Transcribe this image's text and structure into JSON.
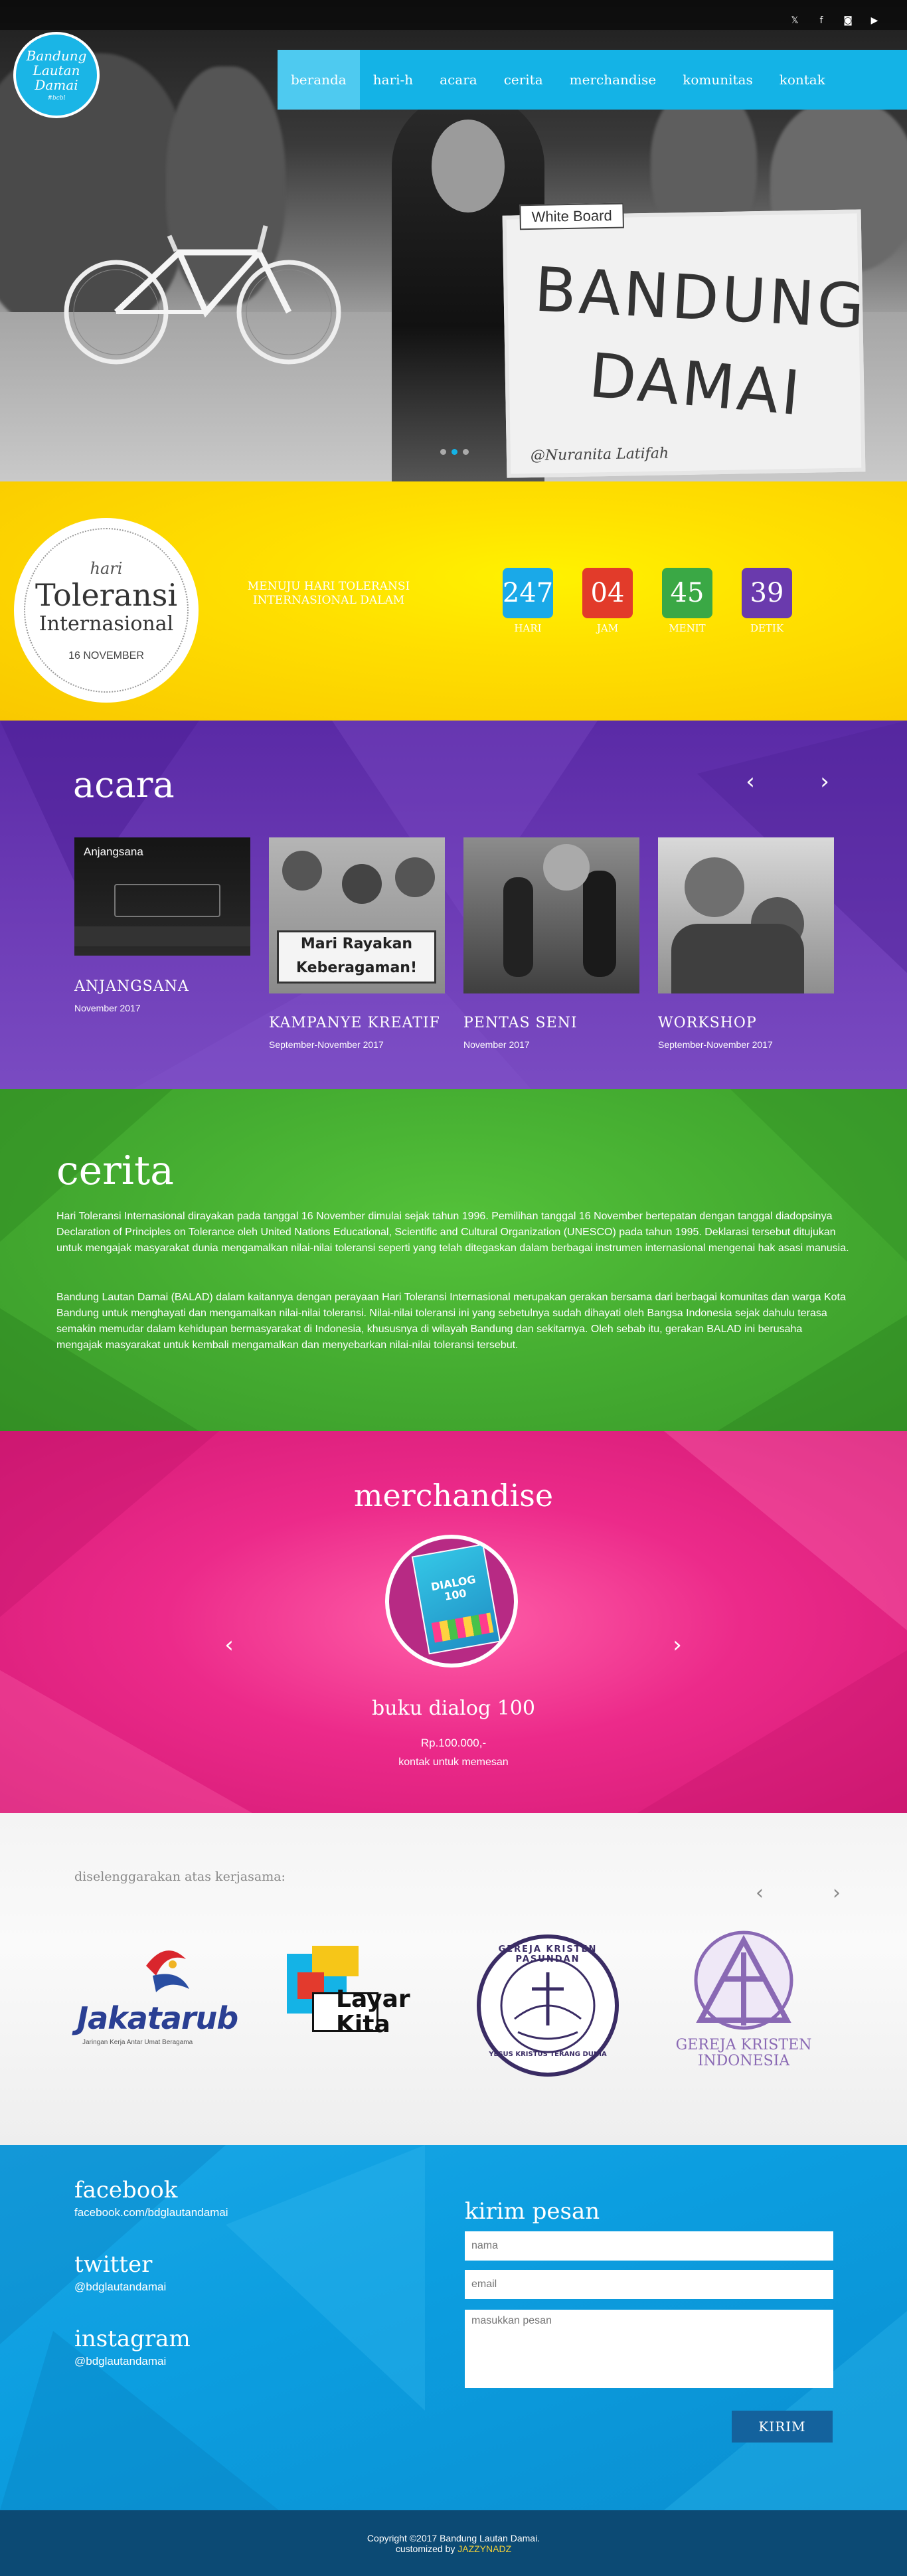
{
  "hero": {
    "social": [
      {
        "icon": "twitter-icon",
        "glyph": "𝕏"
      },
      {
        "icon": "facebook-icon",
        "glyph": "f"
      },
      {
        "icon": "instagram-icon",
        "glyph": "◙"
      },
      {
        "icon": "youtube-icon",
        "glyph": "▶"
      }
    ],
    "logo": {
      "line1": "Bandung",
      "line2": "Lautan",
      "line3": "Damai",
      "tagline": "#bcbl"
    },
    "nav": [
      {
        "label": "beranda",
        "active": true
      },
      {
        "label": "hari-h"
      },
      {
        "label": "acara"
      },
      {
        "label": "cerita"
      },
      {
        "label": "merchandise"
      },
      {
        "label": "komunitas"
      },
      {
        "label": "kontak"
      }
    ],
    "whiteboard": {
      "tag": "White Board",
      "line1": "BANDUNG",
      "line2": "DAMAI",
      "sign": "@Nuranita Latifah"
    }
  },
  "countdown": {
    "badge": {
      "hari": "hari",
      "toleransi": "Toleransi",
      "internasional": "Internasional",
      "date": "16 NOVEMBER"
    },
    "menuju": "MENUJU HARI TOLERANSI INTERNASIONAL DALAM",
    "items": [
      {
        "value": "247",
        "label": "HARI",
        "color": "#1aa9e8"
      },
      {
        "value": "04",
        "label": "JAM",
        "color": "#e23b2a"
      },
      {
        "value": "45",
        "label": "MENIT",
        "color": "#3aa845"
      },
      {
        "value": "39",
        "label": "DETIK",
        "color": "#6a3aad"
      }
    ]
  },
  "acara": {
    "title": "acara",
    "prev": "‹",
    "next": "›",
    "events": [
      {
        "title": "ANJANGSANA",
        "date": "November 2017",
        "img_caption": "Anjangsana"
      },
      {
        "title": "KAMPANYE KREATIF",
        "date": "September-November 2017",
        "img_caption": "Mari Rayakan Keberagaman!"
      },
      {
        "title": "PENTAS SENI",
        "date": "November 2017",
        "img_caption": ""
      },
      {
        "title": "WORKSHOP",
        "date": "September-November 2017",
        "img_caption": ""
      }
    ]
  },
  "cerita": {
    "title": "cerita",
    "p1": "Hari Toleransi Internasional dirayakan pada tanggal 16 November dimulai sejak tahun 1996. Pemilihan tanggal 16 November bertepatan dengan tanggal diadopsinya Declaration of Principles on Tolerance oleh United Nations Educational, Scientific and Cultural Organization (UNESCO) pada tahun 1995. Deklarasi tersebut ditujukan untuk mengajak masyarakat dunia mengamalkan nilai-nilai toleransi seperti yang telah ditegaskan dalam berbagai instrumen internasional mengenai hak asasi manusia.",
    "p2": "Bandung Lautan Damai (BALAD) dalam kaitannya dengan perayaan Hari Toleransi Internasional merupakan gerakan bersama dari berbagai komunitas dan warga Kota Bandung untuk menghayati dan mengamalkan nilai-nilai toleransi. Nilai-nilai toleransi ini yang sebetulnya sudah dihayati oleh Bangsa Indonesia sejak dahulu terasa semakin memudar dalam kehidupan bermasyarakat di Indonesia, khususnya di wilayah Bandung dan sekitarnya. Oleh sebab itu, gerakan BALAD ini berusaha mengajak masyarakat untuk kembali mengamalkan dan menyebarkan nilai-nilai toleransi tersebut."
  },
  "merch": {
    "title": "merchandise",
    "product_name": "buku dialog 100",
    "price": "Rp.100.000,-",
    "contact": "kontak untuk memesan",
    "book_label": "DIALOG 100",
    "prev": "‹",
    "next": "›"
  },
  "partners": {
    "title": "diselenggarakan atas kerjasama:",
    "prev": "‹",
    "next": "›",
    "items": [
      {
        "name": "Jakatarub",
        "sub": "Jaringan Kerja Antar Umat Beragama"
      },
      {
        "name": "Layar Kita"
      },
      {
        "name": "GEREJA KRISTEN PASUNDAN",
        "sub": "YESUS KRISTUS TERANG DUNIA"
      },
      {
        "name": "GEREJA KRISTEN INDONESIA"
      }
    ]
  },
  "contact": {
    "facebook": {
      "label": "facebook",
      "value": "facebook.com/bdglautandamai"
    },
    "twitter": {
      "label": "twitter",
      "value": "@bdglautandamai"
    },
    "instagram": {
      "label": "instagram",
      "value": "@bdglautandamai"
    },
    "form": {
      "title": "kirim pesan",
      "name_placeholder": "nama",
      "email_placeholder": "email",
      "message_placeholder": "masukkan pesan",
      "send": "KIRIM"
    }
  },
  "footer": {
    "copyright": "Copyright ©2017 Bandung Lautan Damai.",
    "customized": "customized by ",
    "brand": "JAZZYNADZ"
  }
}
